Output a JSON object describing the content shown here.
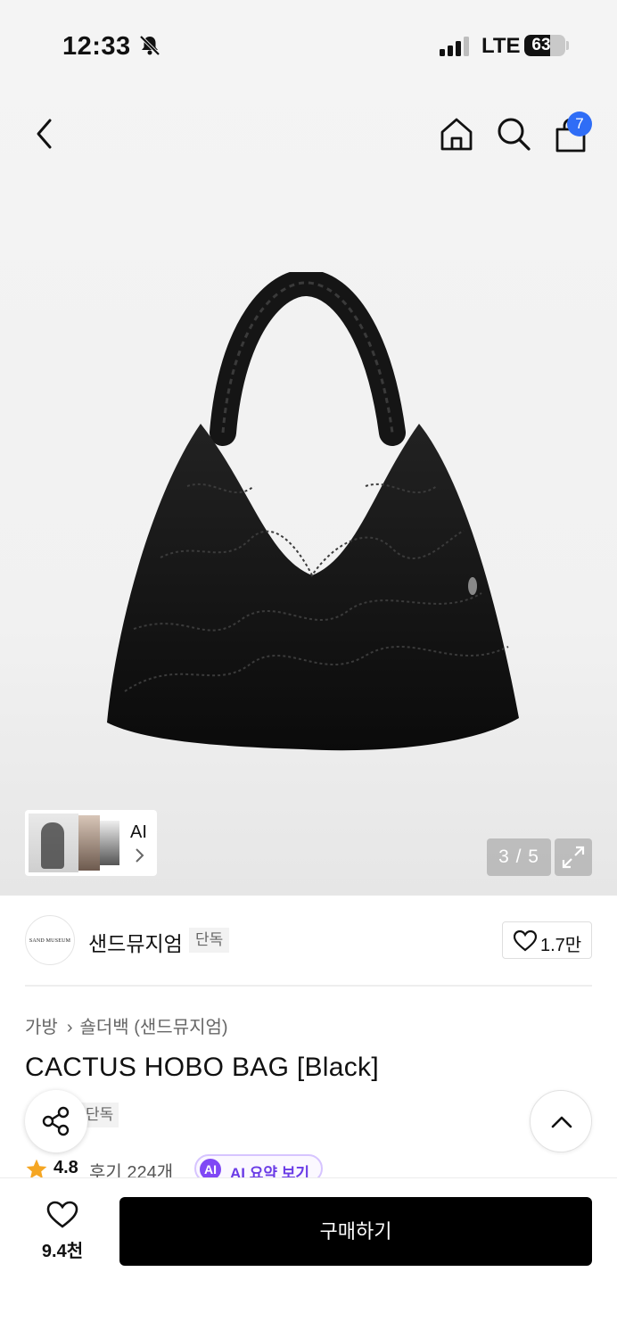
{
  "status_bar": {
    "time": "12:33",
    "network": "LTE",
    "battery": "63"
  },
  "header": {
    "cart_count": "7"
  },
  "gallery": {
    "ai_label": "AI",
    "counter": "3 / 5"
  },
  "brand": {
    "logo_text": "SAND MUSEUM",
    "name": "샌드뮤지엄",
    "tag": "단독",
    "likes": "1.7만"
  },
  "breadcrumb": {
    "category": "가방",
    "separator": "›",
    "subcategory": "숄더백 (샌드뮤지엄)"
  },
  "product": {
    "title": "CACTUS HOBO BAG [Black]",
    "badge": "단독",
    "rating": "4.8",
    "reviews": "후기 224개",
    "ai_icon": "AI",
    "ai_summary": "AI 요약 보기"
  },
  "bottom": {
    "wish_count": "9.4천",
    "buy_label": "구매하기"
  },
  "colors": {
    "accent_blue": "#2f6df6",
    "ai_purple": "#8048f5",
    "star": "#f5a623"
  }
}
